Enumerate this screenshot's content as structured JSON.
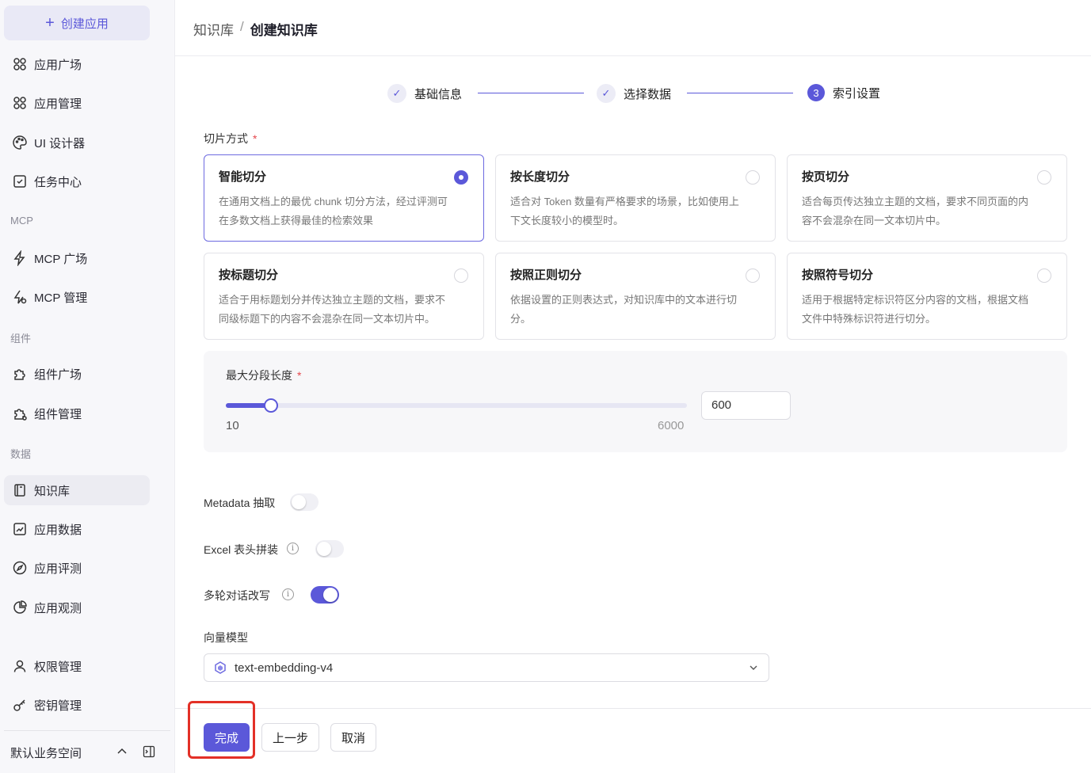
{
  "sidebar": {
    "create_label": "创建应用",
    "items": [
      {
        "label": "应用广场",
        "icon": "apps-icon"
      },
      {
        "label": "应用管理",
        "icon": "apps-manage-icon"
      },
      {
        "label": "UI 设计器",
        "icon": "palette-icon"
      },
      {
        "label": "任务中心",
        "icon": "task-icon"
      },
      {
        "label": "MCP 广场",
        "icon": "bolt-icon"
      },
      {
        "label": "MCP 管理",
        "icon": "bolt-manage-icon"
      },
      {
        "label": "组件广场",
        "icon": "puzzle-icon"
      },
      {
        "label": "组件管理",
        "icon": "puzzle-manage-icon"
      },
      {
        "label": "知识库",
        "icon": "book-icon"
      },
      {
        "label": "应用数据",
        "icon": "chart-icon"
      },
      {
        "label": "应用评测",
        "icon": "compass-icon"
      },
      {
        "label": "应用观测",
        "icon": "pie-icon"
      },
      {
        "label": "权限管理",
        "icon": "user-icon"
      },
      {
        "label": "密钥管理",
        "icon": "key-icon"
      }
    ],
    "sections": [
      "MCP",
      "组件",
      "数据"
    ],
    "workspace": "默认业务空间"
  },
  "breadcrumb": {
    "parent": "知识库",
    "sep": "/",
    "current": "创建知识库"
  },
  "steps": [
    {
      "label": "基础信息",
      "status": "done"
    },
    {
      "label": "选择数据",
      "status": "done"
    },
    {
      "label": "索引设置",
      "status": "current",
      "num": "3"
    }
  ],
  "chunk": {
    "label": "切片方式",
    "required": "*",
    "options": [
      {
        "title": "智能切分",
        "desc": "在通用文档上的最优 chunk 切分方法，经过评测可在多数文档上获得最佳的检索效果",
        "selected": true
      },
      {
        "title": "按长度切分",
        "desc": "适合对 Token 数量有严格要求的场景，比如使用上下文长度较小的模型时。",
        "selected": false
      },
      {
        "title": "按页切分",
        "desc": "适合每页传达独立主题的文档，要求不同页面的内容不会混杂在同一文本切片中。",
        "selected": false
      },
      {
        "title": "按标题切分",
        "desc": "适合于用标题划分并传达独立主题的文档，要求不同级标题下的内容不会混杂在同一文本切片中。",
        "selected": false
      },
      {
        "title": "按照正则切分",
        "desc": "依据设置的正则表达式，对知识库中的文本进行切分。",
        "selected": false
      },
      {
        "title": "按照符号切分",
        "desc": "适用于根据特定标识符区分内容的文档，根据文档文件中特殊标识符进行切分。",
        "selected": false
      }
    ]
  },
  "max_len": {
    "label": "最大分段长度",
    "required": "*",
    "min": "10",
    "max": "6000",
    "value": "600",
    "fraction": 0.098
  },
  "toggles": [
    {
      "label": "Metadata 抽取",
      "on": false,
      "info": false
    },
    {
      "label": "Excel 表头拼装",
      "on": false,
      "info": true
    },
    {
      "label": "多轮对话改写",
      "on": true,
      "info": true
    }
  ],
  "info_glyph": "i",
  "vector": {
    "label": "向量模型",
    "value": "text-embedding-v4"
  },
  "footer": {
    "done": "完成",
    "prev": "上一步",
    "cancel": "取消"
  },
  "colors": {
    "accent": "#5b58d9",
    "highlight": "#e33027"
  }
}
